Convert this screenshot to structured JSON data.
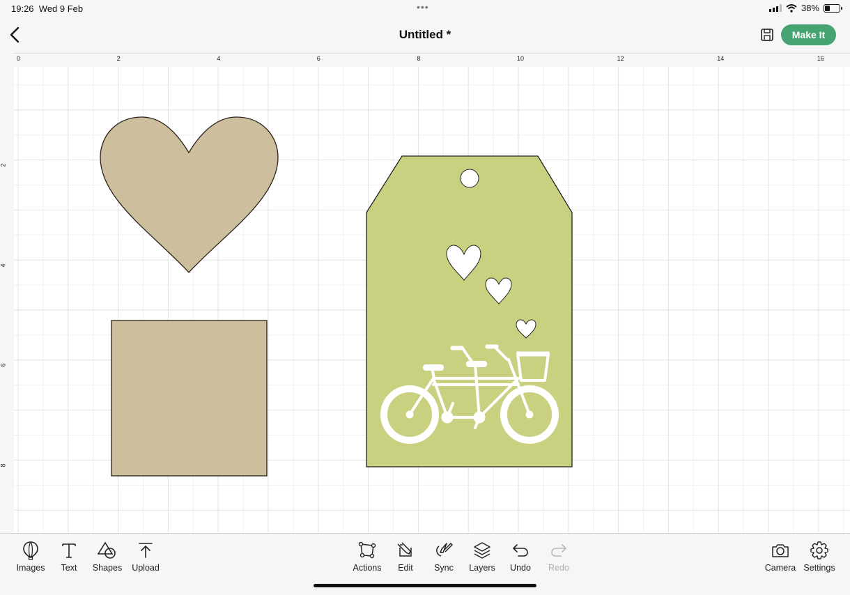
{
  "status_bar": {
    "time": "19:26",
    "date": "Wed 9 Feb",
    "battery": "38%",
    "battery_level": 0.38
  },
  "header": {
    "title": "Untitled *",
    "make_it_label": "Make It"
  },
  "ruler": {
    "horizontal_labels": [
      "0",
      "2",
      "4",
      "6",
      "8",
      "10",
      "12",
      "14",
      "16"
    ],
    "vertical_labels": [
      "2",
      "4",
      "6",
      "8"
    ]
  },
  "canvas_shapes": [
    {
      "name": "heart-shape",
      "color": "#cdbf9e"
    },
    {
      "name": "square-shape",
      "color": "#cdbf9e"
    },
    {
      "name": "tag-shape",
      "color": "#c9d07f"
    }
  ],
  "toolbar": {
    "left": [
      {
        "id": "images",
        "label": "Images",
        "icon": "balloon-icon"
      },
      {
        "id": "text",
        "label": "Text",
        "icon": "text-icon"
      },
      {
        "id": "shapes",
        "label": "Shapes",
        "icon": "shapes-icon"
      },
      {
        "id": "upload",
        "label": "Upload",
        "icon": "upload-icon"
      }
    ],
    "center": [
      {
        "id": "actions",
        "label": "Actions",
        "icon": "actions-icon"
      },
      {
        "id": "edit",
        "label": "Edit",
        "icon": "edit-icon"
      },
      {
        "id": "sync",
        "label": "Sync",
        "icon": "sync-icon"
      },
      {
        "id": "layers",
        "label": "Layers",
        "icon": "layers-icon"
      },
      {
        "id": "undo",
        "label": "Undo",
        "icon": "undo-icon"
      },
      {
        "id": "redo",
        "label": "Redo",
        "icon": "redo-icon",
        "disabled": true
      }
    ],
    "right": [
      {
        "id": "camera",
        "label": "Camera",
        "icon": "camera-icon"
      },
      {
        "id": "settings",
        "label": "Settings",
        "icon": "gear-icon"
      }
    ]
  }
}
